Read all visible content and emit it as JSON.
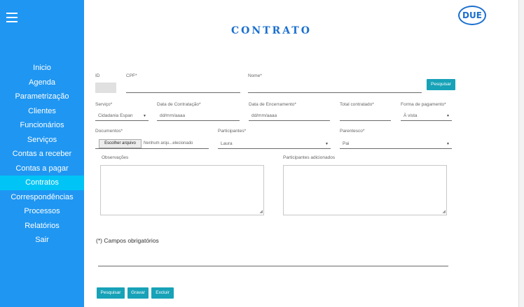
{
  "sidebar": {
    "items": [
      "Inicio",
      "Agenda",
      "Parametrização",
      "Clientes",
      "Funcionários",
      "Serviços",
      "Contas a receber",
      "Contas a pagar",
      "Contratos",
      "Correspondências",
      "Processos",
      "Relatórios",
      "Sair"
    ],
    "active_index": 8
  },
  "header": {
    "title": "CONTRATO",
    "logo": "DUE"
  },
  "form": {
    "id_label": "ID",
    "cpf_label": "CPF*",
    "nome_label": "Nome*",
    "pesquisar_label": "Pesquisar",
    "servico_label": "Serviço*",
    "servico_value": "Cidadania Espan",
    "data_contratacao_label": "Data de Contratação*",
    "data_contratacao_placeholder": "dd/mm/aaaa",
    "data_encerramento_label": "Data de Encerramento*",
    "data_encerramento_placeholder": "dd/mm/aaaa",
    "total_label": "Total contratado*",
    "forma_pagamento_label": "Forma de pagamento*",
    "forma_pagamento_value": "À vista",
    "documentos_label": "Documentos*",
    "file_button": "Escolher arquivo",
    "file_status": "Nenhum arqu...elecionado",
    "participantes_label": "Participantes*",
    "participantes_value": "Laura",
    "parentesco_label": "Parentesco*",
    "parentesco_value": "Pai",
    "observacoes_label": "Observações",
    "participantes_adicionados_label": "Participantes adicionados",
    "campos_obrigatorios": "(*) Campos obrigatórios"
  },
  "actions": {
    "pesquisar": "Pesquisar",
    "gravar": "Gravar",
    "excluir": "Excluir"
  },
  "colors": {
    "sidebar": "#1f96f2",
    "active_item": "#00c4f5",
    "button": "#17a2b8",
    "title": "#1a6fcf"
  }
}
